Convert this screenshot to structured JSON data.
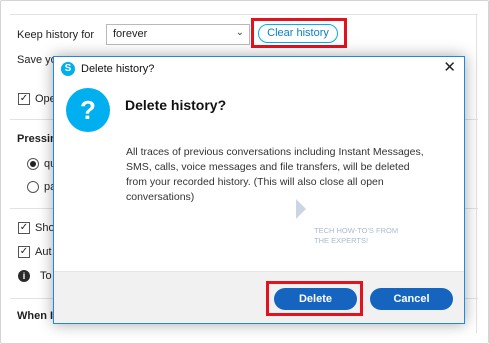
{
  "settings": {
    "keep_history_label": "Keep history for",
    "keep_history_value": "forever",
    "clear_history_button": "Clear history",
    "save_label": "Save yo",
    "open_option": "Ope",
    "pressing_section": "Pressin",
    "radio_1": "qu",
    "radio_2": "pa",
    "show_option": "Sho",
    "auto_option": "Aut",
    "info_text": "To",
    "when_section": "When I"
  },
  "dialog": {
    "window_title": "Delete history?",
    "heading": "Delete history?",
    "body": "All traces of previous conversations including Instant Messages, SMS, calls, voice messages and file transfers, will be deleted from your recorded history. (This will also close all open conversations)",
    "delete_button": "Delete",
    "cancel_button": "Cancel",
    "close_glyph": "✕",
    "icons": {
      "app": "skype-icon",
      "question": "question-icon",
      "close": "close-icon"
    }
  },
  "watermark": {
    "line1": "TECH HOW-TO'S FROM",
    "line2": "THE EXPERTS!"
  },
  "colors": {
    "accent": "#00aff0",
    "button": "#1565c0",
    "highlight": "#e0131f"
  }
}
